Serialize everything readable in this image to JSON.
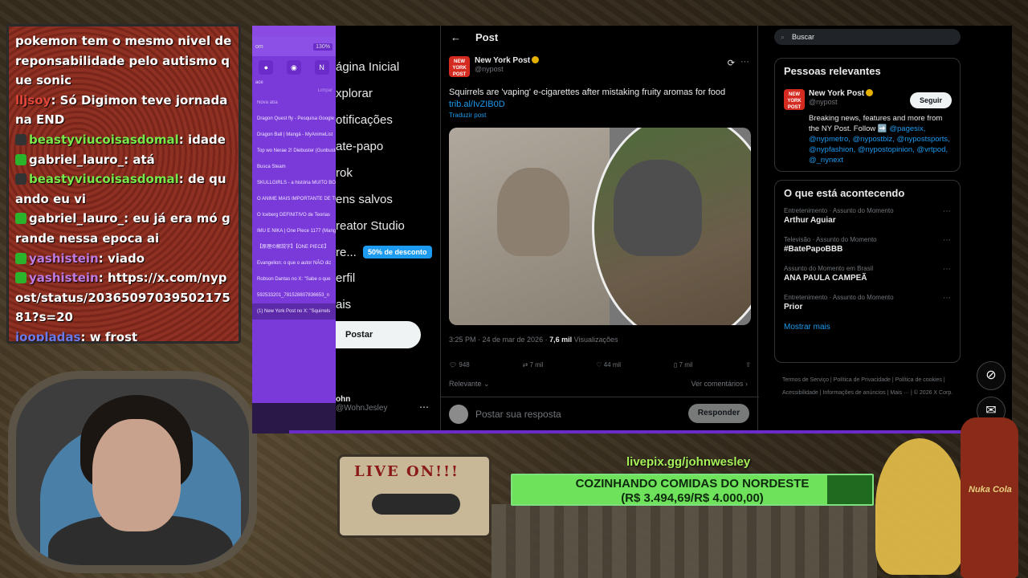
{
  "chat": {
    "lines": [
      {
        "text": "pokemon tem o mesmo nivel de reponsabilidade pelo autismo que sonic"
      },
      {
        "user": "lljsoy",
        "user_color": "#e0473a",
        "text": ": Só Digimon teve jornada na END"
      },
      {
        "user": "beastyviucoisasdomal",
        "user_color": "#79e84a",
        "text": ": idade"
      },
      {
        "user": "gabriel_lauro_",
        "user_color": "#ffffff",
        "text": ": atá"
      },
      {
        "user": "beastyviucoisasdomal",
        "user_color": "#79e84a",
        "text": ": de quando eu vi"
      },
      {
        "user": "gabriel_lauro_",
        "user_color": "#ffffff",
        "text": ": eu já era mó grande nessa epoca ai"
      },
      {
        "user": "yashistein",
        "user_color": "#c07ae0",
        "text": ": viado"
      },
      {
        "user": "yashistein",
        "user_color": "#c07ae0",
        "text": ": https://x.com/nypost/status/2036509703950217581?s=20"
      },
      {
        "user": "joopladas",
        "user_color": "#6a7ae8",
        "text": ": w frost"
      }
    ]
  },
  "browser": {
    "zoom": "130%",
    "section": "Nova aba",
    "tabs": [
      "Dragon Quest fly - Pesquisa Google",
      "Dragon Ball | Mangá - MyAnimeList",
      "Top wo Nerae 2! Diebuster (Gunbuster 2)",
      "Busca Steam",
      "SKULLGIRLS - a história MUITO BOA",
      "O ANIME MAIS IMPORTANTE DE TODOS",
      "O Iceberg DEFINITIVO de Teorias",
      "IMU E NIKA | One Piece 1177 (Mangá)",
      "【原理の解説字】【ONE PIECE】",
      "Evangelion: o que o autor NÃO diz",
      "Robson Dantas no X: \"Sabe o que",
      "592533201_781528807836653_n",
      "(1) New York Post no X: \"Squirrels"
    ],
    "misc": "Limpar",
    "partial_top": "om",
    "partial_label": "ace"
  },
  "twitter": {
    "nav": [
      "ágina Inicial",
      "xplorar",
      "otificações",
      "ate-papo",
      "rok",
      "ens salvos",
      "reator Studio",
      "re...",
      "erfil",
      "ais"
    ],
    "promo": "50% de desconto",
    "post_button": "Postar",
    "user_name": "ohn",
    "user_handle": "@WohnJesley",
    "header": "Post",
    "author": "New York Post",
    "handle": "@nypost",
    "tweet_text": "Squirrels are 'vaping' e-cigarettes after mistaking fruity aromas for food",
    "tweet_link": "trib.al/IvZIB0D",
    "translate": "Traduzir post",
    "time": "3:25 PM · 24 de mar de 2026 ·",
    "views": "7,6 mil",
    "views_label": "Visualizações",
    "replies": "948",
    "retweets": "7 mil",
    "likes": "44 mil",
    "bookmarks": "7 mil",
    "relevant": "Relevante",
    "view_comments": "Ver comentários",
    "reply_placeholder": "Postar sua resposta",
    "reply_button": "Responder",
    "search_placeholder": "Buscar",
    "relevant_people_title": "Pessoas relevantes",
    "follow": "Seguir",
    "bio_text": "Breaking news, features and more from the NY Post. Follow ➡️",
    "bio_links": "@pagesix, @nypmetro, @nypostbiz, @nypostsports, @nypfashion, @nypostopinion, @vrtpod, @_nynext",
    "happening_title": "O que está acontecendo",
    "trends": [
      {
        "category": "Entretenimento · Assunto do Momento",
        "title": "Arthur Aguiar"
      },
      {
        "category": "Televisão · Assunto do Momento",
        "title": "#BatePapoBBB"
      },
      {
        "category": "Assunto do Momento em Brasil",
        "title": "ANA PAULA CAMPEÃ"
      },
      {
        "category": "Entretenimento · Assunto do Momento",
        "title": "Prior"
      }
    ],
    "show_more": "Mostrar mais",
    "footer": "Termos de Serviço | Política de Privacidade | Política de cookies | Acessibilidade | Informações de anúncios | Mais ··· | © 2026 X Corp."
  },
  "overlay": {
    "livepix": "livepix.gg/johnwesley",
    "goal_line1": "COZINHANDO COMIDAS DO NORDESTE",
    "goal_line2": "(R$ 3.494,69/R$ 4.000,00)",
    "goal_progress": 0.874,
    "cassette_label": "LIVE ON!!!",
    "bottle_label": "Nuka Cola"
  },
  "colors": {
    "accent": "#1d9bf0",
    "goal": "#6ee25a",
    "browser": "#7a39d9"
  }
}
